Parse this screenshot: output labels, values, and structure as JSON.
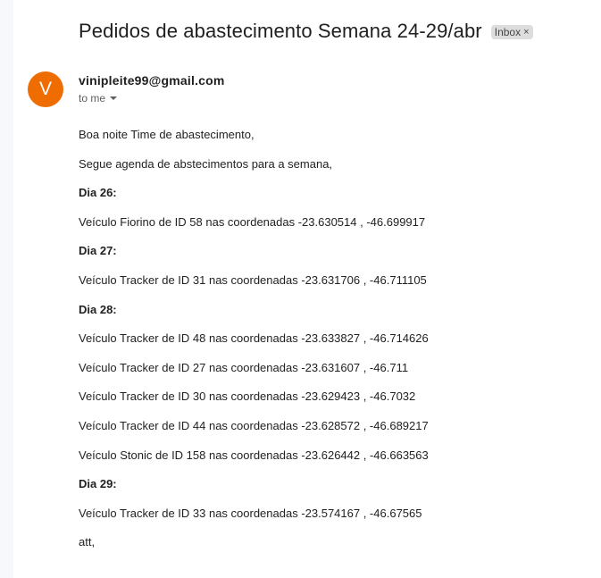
{
  "email": {
    "subject": "Pedidos de abastecimento Semana 24-29/abr",
    "label": "Inbox",
    "label_close": "×",
    "sender_initial": "V",
    "sender": "vinipleite99@gmail.com",
    "recipient": "to me",
    "avatar_color": "#ef6c00",
    "body": [
      {
        "text": "Boa noite Time de abastecimento,",
        "bold": false
      },
      {
        "text": "Segue agenda de abstecimentos para a semana,",
        "bold": false
      },
      {
        "text": "Dia 26:",
        "bold": true
      },
      {
        "text": "Veículo Fiorino de ID 58 nas coordenadas -23.630514 , -46.699917",
        "bold": false
      },
      {
        "text": "Dia 27:",
        "bold": true
      },
      {
        "text": "Veículo Tracker de ID 31 nas coordenadas -23.631706 , -46.711105",
        "bold": false
      },
      {
        "text": "Dia 28:",
        "bold": true
      },
      {
        "text": "Veículo Tracker de ID 48 nas coordenadas -23.633827 , -46.714626",
        "bold": false
      },
      {
        "text": "Veículo Tracker de ID 27 nas coordenadas -23.631607 , -46.711",
        "bold": false
      },
      {
        "text": "Veículo Tracker de ID 30 nas coordenadas -23.629423 , -46.7032",
        "bold": false
      },
      {
        "text": "Veículo Tracker de ID 44 nas coordenadas -23.628572 , -46.689217",
        "bold": false
      },
      {
        "text": "Veículo Stonic de ID 158 nas coordenadas -23.626442 , -46.663563",
        "bold": false
      },
      {
        "text": "Dia 29:",
        "bold": true
      },
      {
        "text": "Veículo Tracker de ID 33 nas coordenadas -23.574167 , -46.67565",
        "bold": false
      },
      {
        "text": "att,",
        "bold": false
      }
    ]
  }
}
